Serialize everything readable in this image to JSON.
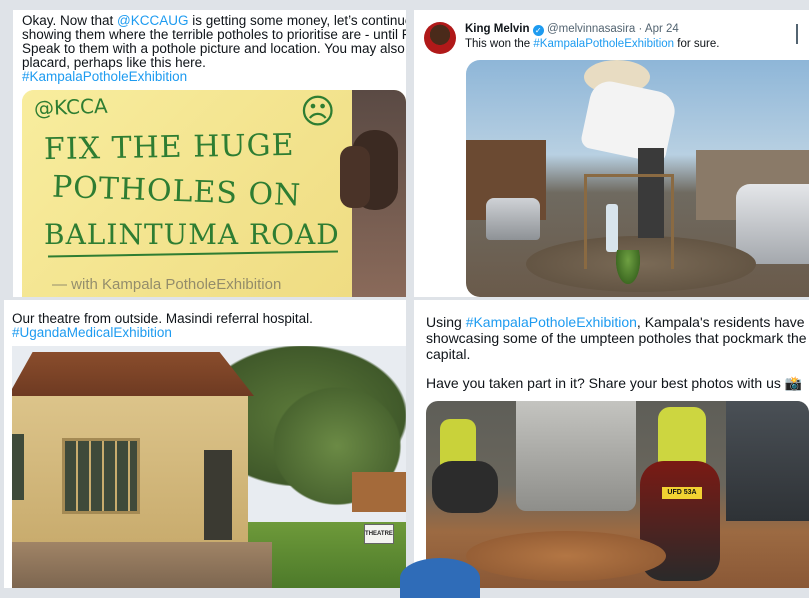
{
  "tweet1": {
    "lines": [
      {
        "pre": "Okay. Now that ",
        "mention": "@KCCAUG",
        "post": " is getting some money, let’s continue"
      },
      {
        "text": "showing them where the terrible potholes to prioritise are - until Friday."
      },
      {
        "text": "Speak to them with a pothole picture and location. You may also write a"
      },
      {
        "text": "placard,  perhaps like this here."
      }
    ],
    "hashtag": "#KampalaPotholeExhibition",
    "placard": {
      "handle": "@KCCA",
      "line1": "FIX THE HUGE",
      "line2": "POTHOLES ON",
      "line3": "BALINTUMA ROAD",
      "smiley": "☹",
      "bottom_scrawl": "— with Kampala PotholeExhibition"
    }
  },
  "tweet2": {
    "line1": "Our theatre from outside. Masindi referral hospital.",
    "hashtag": "#UgandaMedicalExhibition",
    "sign_text": "THEATRE"
  },
  "tweet3": {
    "author": "King Melvin",
    "handle": "@melvinnasasira",
    "date": "Apr 24",
    "separator": "·",
    "text_pre": "This won the ",
    "hashtag": "#KampalaPotholeExhibition",
    "text_post": " for sure."
  },
  "tweet4": {
    "line1_pre": "Using ",
    "hashtag": "#KampalaPotholeExhibition",
    "line1_post": ", Kampala's residents have",
    "line2": "showcasing some of the umpteen potholes that pockmark the",
    "line3": "capital.",
    "line5": "Have you taken part in it? Share your best photos with us",
    "emoji": "📸",
    "moto_plate": "UFD 53A"
  },
  "colors": {
    "link": "#1d9bf0",
    "verified": "#1d9bf0",
    "placard": "#f5e89a",
    "marker": "#2e7d32"
  }
}
